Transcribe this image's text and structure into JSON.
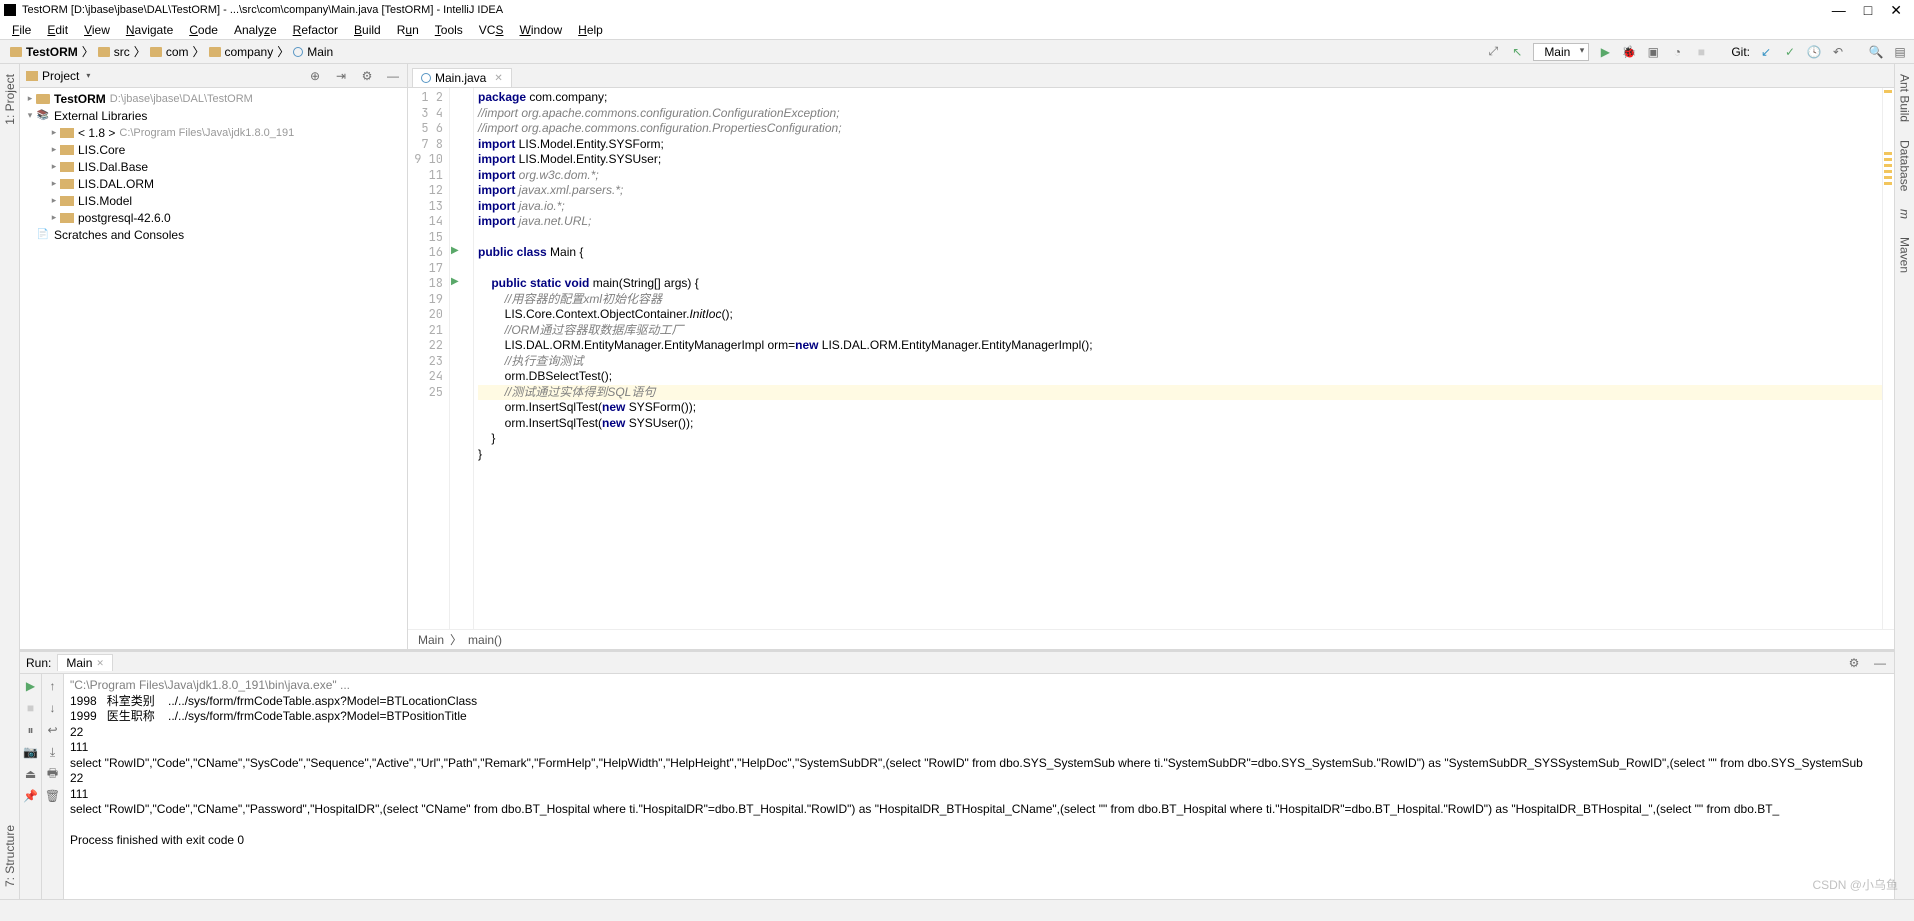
{
  "window": {
    "title": "TestORM [D:\\jbase\\jbase\\DAL\\TestORM] - ...\\src\\com\\company\\Main.java [TestORM] - IntelliJ IDEA"
  },
  "menu": {
    "file": "File",
    "edit": "Edit",
    "view": "View",
    "navigate": "Navigate",
    "code": "Code",
    "analyze": "Analyze",
    "refactor": "Refactor",
    "build": "Build",
    "run": "Run",
    "tools": "Tools",
    "vcs": "VCS",
    "window": "Window",
    "help": "Help"
  },
  "crumbs": {
    "c0": "TestORM",
    "c1": "src",
    "c2": "com",
    "c3": "company",
    "c4": "Main"
  },
  "run_config": "Main",
  "git_label": "Git:",
  "left_tabs": {
    "project": "1: Project",
    "structure": "7: Structure"
  },
  "right_tabs": {
    "ant": "Ant Build",
    "database": "Database",
    "maven": "Maven",
    "m": "m"
  },
  "project": {
    "header": "Project",
    "root": "TestORM",
    "root_hint": "D:\\jbase\\jbase\\DAL\\TestORM",
    "ext": "External Libraries",
    "jdk": "< 1.8 >",
    "jdk_hint": "C:\\Program Files\\Java\\jdk1.8.0_191",
    "libs": [
      "LIS.Core",
      "LIS.Dal.Base",
      "LIS.DAL.ORM",
      "LIS.Model",
      "postgresql-42.6.0"
    ],
    "scratches": "Scratches and Consoles"
  },
  "editor": {
    "tab": "Main.java",
    "lines": {
      "l1a": "package",
      "l1b": " com.company;",
      "l2": "//import org.apache.commons.configuration.ConfigurationException;",
      "l3": "//import org.apache.commons.configuration.PropertiesConfiguration;",
      "l4a": "import",
      "l4b": " LIS.Model.Entity.SYSForm;",
      "l5a": "import",
      "l5b": " LIS.Model.Entity.SYSUser;",
      "l6a": "import",
      "l6b": " org.w3c.dom.*;",
      "l7a": "import",
      "l7b": " javax.xml.parsers.*;",
      "l8a": "import",
      "l8b": " java.io.*;",
      "l9a": "import",
      "l9b": " java.net.URL;",
      "l11a": "public class",
      "l11b": " Main {",
      "l13a": "    public static void",
      "l13b": " main(String[] args) {",
      "l14": "        //用容器的配置xml初始化容器",
      "l15a": "        LIS.Core.Context.ObjectContainer.",
      "l15b": "InitIoc",
      "l15c": "();",
      "l16": "        //ORM通过容器取数据库驱动工厂",
      "l17a": "        LIS.DAL.ORM.EntityManager.EntityManagerImpl orm=",
      "l17b": "new",
      "l17c": " LIS.DAL.ORM.EntityManager.EntityManagerImpl();",
      "l18": "        //执行查询测试",
      "l19": "        orm.DBSelectTest();",
      "l20": "        //测试通过实体得到SQL语句",
      "l21a": "        orm.InsertSqlTest(",
      "l21b": "new",
      "l21c": " SYSForm());",
      "l22a": "        orm.InsertSqlTest(",
      "l22b": "new",
      "l22c": " SYSUser());",
      "l23": "    }",
      "l24": "}"
    },
    "bc1": "Main",
    "bc2": "main()"
  },
  "run": {
    "label": "Run:",
    "tab": "Main",
    "out1": "\"C:\\Program Files\\Java\\jdk1.8.0_191\\bin\\java.exe\" ...",
    "out2": "1998   科室类别    ../../sys/form/frmCodeTable.aspx?Model=BTLocationClass",
    "out3": "1999   医生职称    ../../sys/form/frmCodeTable.aspx?Model=BTPositionTitle",
    "out4": "22",
    "out5": "111",
    "out6": "select \"RowID\",\"Code\",\"CName\",\"SysCode\",\"Sequence\",\"Active\",\"Url\",\"Path\",\"Remark\",\"FormHelp\",\"HelpWidth\",\"HelpHeight\",\"HelpDoc\",\"SystemSubDR\",(select \"RowID\" from dbo.SYS_SystemSub where ti.\"SystemSubDR\"=dbo.SYS_SystemSub.\"RowID\") as \"SystemSubDR_SYSSystemSub_RowID\",(select \"\" from dbo.SYS_SystemSub",
    "out7": "22",
    "out8": "111",
    "out9": "select \"RowID\",\"Code\",\"CName\",\"Password\",\"HospitalDR\",(select \"CName\" from dbo.BT_Hospital where ti.\"HospitalDR\"=dbo.BT_Hospital.\"RowID\") as \"HospitalDR_BTHospital_CName\",(select \"\" from dbo.BT_Hospital where ti.\"HospitalDR\"=dbo.BT_Hospital.\"RowID\") as \"HospitalDR_BTHospital_\",(select \"\" from dbo.BT_",
    "out10": "",
    "out11": "Process finished with exit code 0"
  },
  "watermark": "CSDN @小乌鱼"
}
